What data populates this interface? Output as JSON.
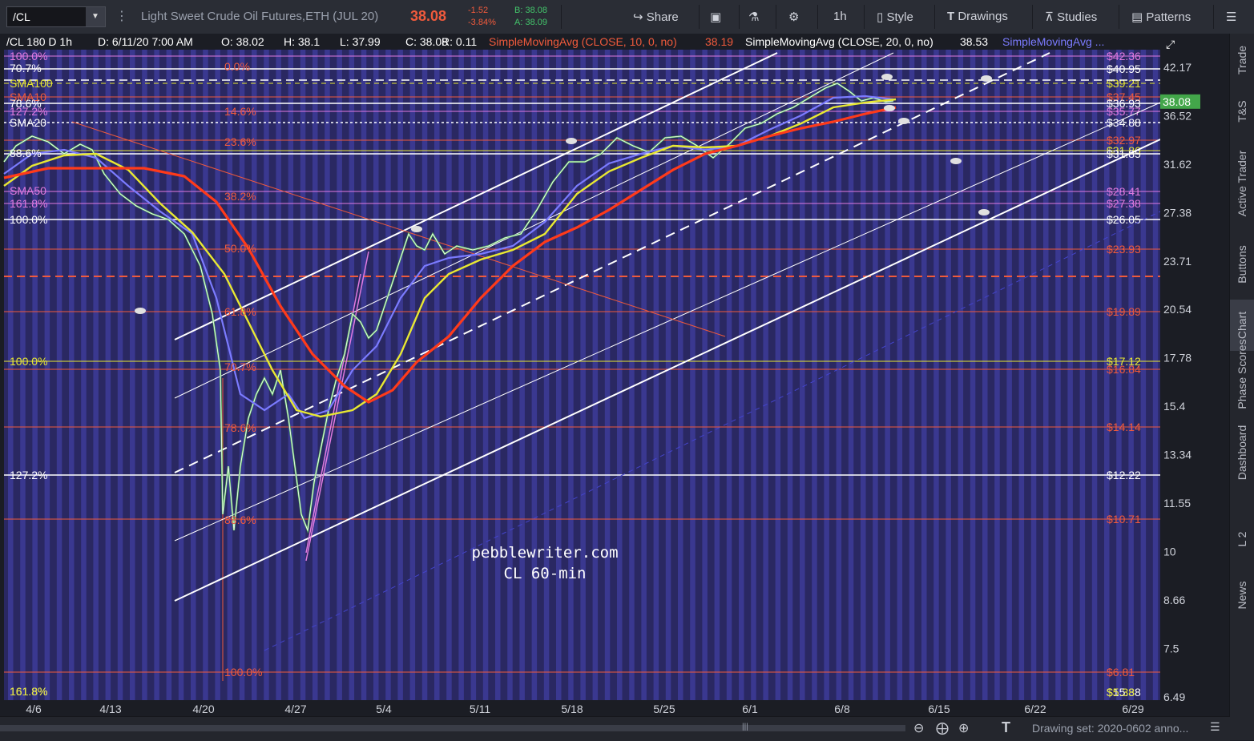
{
  "toolbar": {
    "symbol": "/CL",
    "description": "Light Sweet Crude Oil Futures,ETH (JUL 20)",
    "last": "38.08",
    "change": "-1.52",
    "change_pct": "-3.84%",
    "bid": "B: 38.08",
    "ask": "A: 38.09",
    "share": "Share",
    "interval": "1h",
    "style": "Style",
    "drawings": "Drawings",
    "studies": "Studies",
    "patterns": "Patterns"
  },
  "header": {
    "symbol_info": "/CL 180 D 1h",
    "date": "D: 6/11/20 7:00 AM",
    "open": "O: 38.02",
    "high": "H: 38.1",
    "low": "L: 37.99",
    "close": "C: 38.08",
    "range": "R: 0.11",
    "sma10_label": "SimpleMovingAvg (CLOSE, 10, 0, no)",
    "sma10_value": "38.19",
    "sma20_label": "SimpleMovingAvg (CLOSE, 20, 0, no)",
    "sma20_value": "38.53",
    "sma_more": "SimpleMovingAvg ..."
  },
  "price_axis": [
    "42.17",
    "36.52",
    "31.62",
    "27.38",
    "23.71",
    "20.54",
    "17.78",
    "15.4",
    "13.34",
    "11.55",
    "10",
    "8.66",
    "7.5",
    "6.49"
  ],
  "current_price": "38.08",
  "date_axis": [
    "4/6",
    "4/13",
    "4/20",
    "4/27",
    "5/4",
    "5/11",
    "5/18",
    "5/25",
    "6/1",
    "6/8",
    "6/15",
    "6/22",
    "6/29"
  ],
  "price_tags": [
    {
      "text": "$42.36",
      "color": "#e07ae0"
    },
    {
      "text": "$40.95",
      "color": "#ffffff"
    },
    {
      "text": "$39.21",
      "color": "#e8e832"
    },
    {
      "text": "$37.45",
      "color": "#f05a3c"
    },
    {
      "text": "$36.93",
      "color": "#ffffff"
    },
    {
      "text": "$35.77",
      "color": "#e07ae0"
    },
    {
      "text": "$34.88",
      "color": "#ffffff"
    },
    {
      "text": "$32.97",
      "color": "#f05a3c"
    },
    {
      "text": "$31.86",
      "color": "#e8e832"
    },
    {
      "text": "$31.85",
      "color": "#ffffff"
    },
    {
      "text": "$28.41",
      "color": "#e07ae0"
    },
    {
      "text": "$27.38",
      "color": "#e07ae0"
    },
    {
      "text": "$26.05",
      "color": "#ffffff"
    },
    {
      "text": "$23.93",
      "color": "#f05a3c"
    },
    {
      "text": "$19.89",
      "color": "#f05a3c"
    },
    {
      "text": "$17.12",
      "color": "#e8e832"
    },
    {
      "text": "$16.84",
      "color": "#f05a3c"
    },
    {
      "text": "$14.14",
      "color": "#f05a3c"
    },
    {
      "text": "$12.22",
      "color": "#ffffff"
    },
    {
      "text": "$10.71",
      "color": "#f05a3c"
    },
    {
      "text": "$6.81",
      "color": "#f05a3c"
    },
    {
      "text": "$15.38",
      "color": "#ffffff"
    },
    {
      "text": "$5.38",
      "color": "#e8e832"
    }
  ],
  "left_labels": [
    {
      "text": "100.0%",
      "color": "#e07ae0"
    },
    {
      "text": "70.7%",
      "color": "#ffffff"
    },
    {
      "text": "SMA100",
      "color": "#e8e832"
    },
    {
      "text": "SMA10",
      "color": "#f05a3c"
    },
    {
      "text": "78.6%",
      "color": "#ffffff"
    },
    {
      "text": "127.2%",
      "color": "#e07ae0"
    },
    {
      "text": "SMA20",
      "color": "#ffffff"
    },
    {
      "text": "88.6%",
      "color": "#ffffff"
    },
    {
      "text": "SMA50",
      "color": "#e07ae0"
    },
    {
      "text": "161.8%",
      "color": "#e07ae0"
    },
    {
      "text": "100.0%",
      "color": "#ffffff"
    },
    {
      "text": "100.0%",
      "color": "#e8e832"
    },
    {
      "text": "127.2%",
      "color": "#ffffff"
    },
    {
      "text": "161.8%",
      "color": "#ffffff"
    },
    {
      "text": "161.8%",
      "color": "#e8e832"
    }
  ],
  "fib_labels": [
    {
      "text": "0.0%"
    },
    {
      "text": "14.6%"
    },
    {
      "text": "23.6%"
    },
    {
      "text": "38.2%"
    },
    {
      "text": "50.0%"
    },
    {
      "text": "61.8%"
    },
    {
      "text": "70.7%"
    },
    {
      "text": "78.6%"
    },
    {
      "text": "88.6%"
    },
    {
      "text": "100.0%"
    }
  ],
  "watermark": [
    "pebblewriter.com",
    "CL 60-min"
  ],
  "sidebar_tabs": [
    "Trade",
    "T&S",
    "Active Trader",
    "Buttons",
    "Chart",
    "Phase Scores",
    "Dashboard",
    "L 2",
    "News"
  ],
  "active_tab": "Chart",
  "bottom_status": "Drawing set: 2020-0602 anno...",
  "colors": {
    "bg": "#2a2862",
    "stripe": "#3a3890",
    "white": "#ffffff",
    "yellow": "#e8e832",
    "red": "#f05a3c",
    "magenta": "#e07ae0",
    "blue": "#7b7bff"
  }
}
